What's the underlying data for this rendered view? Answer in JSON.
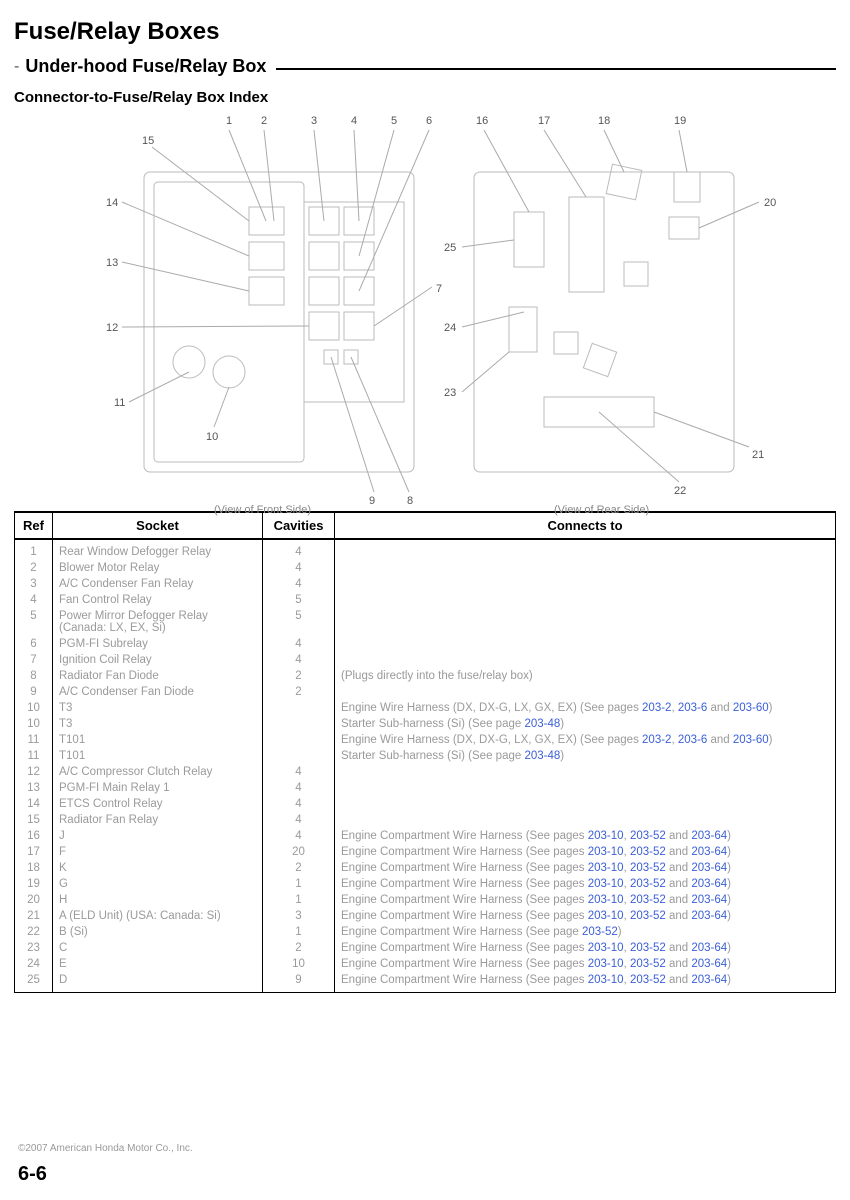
{
  "header": {
    "title": "Fuse/Relay Boxes",
    "subtitle": "Under-hood Fuse/Relay Box",
    "index_label": "Connector-to-Fuse/Relay Box Index"
  },
  "diagram": {
    "caption_left": "(View of Front Side)",
    "caption_right": "(View of Rear Side)",
    "callouts_left": [
      "1",
      "2",
      "3",
      "4",
      "5",
      "6",
      "7",
      "8",
      "9",
      "10",
      "11",
      "12",
      "13",
      "14",
      "15"
    ],
    "callouts_right": [
      "16",
      "17",
      "18",
      "19",
      "20",
      "21",
      "22",
      "23",
      "24",
      "25"
    ]
  },
  "table": {
    "headers": [
      "Ref",
      "Socket",
      "Cavities",
      "Connects to"
    ],
    "rows": [
      {
        "ref": "1",
        "socket": "Rear Window Defogger Relay",
        "cav": "4",
        "conn": ""
      },
      {
        "ref": "2",
        "socket": "Blower Motor Relay",
        "cav": "4",
        "conn": ""
      },
      {
        "ref": "3",
        "socket": "A/C Condenser Fan Relay",
        "cav": "4",
        "conn": ""
      },
      {
        "ref": "4",
        "socket": "Fan Control Relay",
        "cav": "5",
        "conn": ""
      },
      {
        "ref": "5",
        "socket": "Power Mirror Defogger Relay (Canada: LX, EX, Si)",
        "cav": "5",
        "conn": ""
      },
      {
        "ref": "6",
        "socket": "PGM-FI Subrelay",
        "cav": "4",
        "conn": ""
      },
      {
        "ref": "7",
        "socket": "Ignition Coil Relay",
        "cav": "4",
        "conn": ""
      },
      {
        "ref": "8",
        "socket": "Radiator Fan Diode",
        "cav": "2",
        "conn": "(Plugs directly into the fuse/relay box)"
      },
      {
        "ref": "9",
        "socket": "A/C Condenser Fan Diode",
        "cav": "2",
        "conn": ""
      },
      {
        "ref": "10",
        "socket": "T3",
        "cav": "",
        "conn": "Engine Wire Harness (DX, DX-G, LX, GX, EX) (See pages <a class='link'>203-2</a>, <a class='link'>203-6</a> and <a class='link'>203-60</a>)"
      },
      {
        "ref": "10",
        "socket": "T3",
        "cav": "",
        "conn": "Starter Sub-harness (Si) (See page <a class='link'>203-48</a>)"
      },
      {
        "ref": "11",
        "socket": "T101",
        "cav": "",
        "conn": "Engine Wire Harness (DX, DX-G, LX, GX, EX) (See pages <a class='link'>203-2</a>, <a class='link'>203-6</a> and <a class='link'>203-60</a>)"
      },
      {
        "ref": "11",
        "socket": "T101",
        "cav": "",
        "conn": "Starter Sub-harness (Si) (See page <a class='link'>203-48</a>)"
      },
      {
        "ref": "12",
        "socket": "A/C Compressor Clutch Relay",
        "cav": "4",
        "conn": ""
      },
      {
        "ref": "13",
        "socket": "PGM-FI Main Relay 1",
        "cav": "4",
        "conn": ""
      },
      {
        "ref": "14",
        "socket": "ETCS Control Relay",
        "cav": "4",
        "conn": ""
      },
      {
        "ref": "15",
        "socket": "Radiator Fan Relay",
        "cav": "4",
        "conn": ""
      },
      {
        "ref": "16",
        "socket": "J",
        "cav": "4",
        "conn": "Engine Compartment Wire Harness (See pages <a class='link'>203-10</a>, <a class='link'>203-52</a> and <a class='link'>203-64</a>)"
      },
      {
        "ref": "17",
        "socket": "F",
        "cav": "20",
        "conn": "Engine Compartment Wire Harness (See pages <a class='link'>203-10</a>, <a class='link'>203-52</a> and <a class='link'>203-64</a>)"
      },
      {
        "ref": "18",
        "socket": "K",
        "cav": "2",
        "conn": "Engine Compartment Wire Harness (See pages <a class='link'>203-10</a>, <a class='link'>203-52</a> and <a class='link'>203-64</a>)"
      },
      {
        "ref": "19",
        "socket": "G",
        "cav": "1",
        "conn": "Engine Compartment Wire Harness (See pages <a class='link'>203-10</a>, <a class='link'>203-52</a> and <a class='link'>203-64</a>)"
      },
      {
        "ref": "20",
        "socket": "H",
        "cav": "1",
        "conn": "Engine Compartment Wire Harness (See pages <a class='link'>203-10</a>, <a class='link'>203-52</a> and <a class='link'>203-64</a>)"
      },
      {
        "ref": "21",
        "socket": "A (ELD Unit) (USA: Canada: Si)",
        "cav": "3",
        "conn": "Engine Compartment Wire Harness (See pages <a class='link'>203-10</a>, <a class='link'>203-52</a> and <a class='link'>203-64</a>)"
      },
      {
        "ref": "22",
        "socket": "B (Si)",
        "cav": "1",
        "conn": "Engine Compartment Wire Harness (See page <a class='link'>203-52</a>)"
      },
      {
        "ref": "23",
        "socket": "C",
        "cav": "2",
        "conn": "Engine Compartment Wire Harness (See pages <a class='link'>203-10</a>, <a class='link'>203-52</a> and <a class='link'>203-64</a>)"
      },
      {
        "ref": "24",
        "socket": "E",
        "cav": "10",
        "conn": "Engine Compartment Wire Harness (See pages <a class='link'>203-10</a>, <a class='link'>203-52</a> and <a class='link'>203-64</a>)"
      },
      {
        "ref": "25",
        "socket": "D",
        "cav": "9",
        "conn": "Engine Compartment Wire Harness (See pages <a class='link'>203-10</a>, <a class='link'>203-52</a> and <a class='link'>203-64</a>)"
      }
    ]
  },
  "footer": {
    "copyright": "©2007 American Honda Motor Co., Inc.",
    "page": "6-6"
  }
}
